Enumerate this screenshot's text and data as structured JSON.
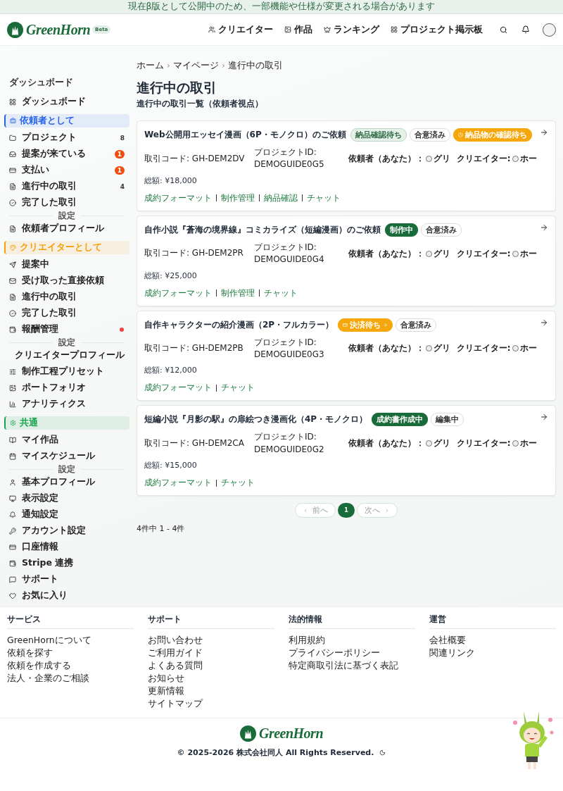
{
  "banner": "現在β版として公開中のため、一部機能や仕様が変更される場合があります",
  "header": {
    "logo": "GreenHorn",
    "badge": "Beta",
    "nav": [
      "クリエイター",
      "作品",
      "ランキング",
      "プロジェクト掲示板"
    ]
  },
  "sidebar": [
    {
      "kind": "label",
      "label": "ダッシュボード"
    },
    {
      "kind": "item",
      "label": "ダッシュボード",
      "alert": false
    },
    {
      "kind": "section",
      "label": "依頼者として",
      "color": "#2563eb"
    },
    {
      "kind": "item",
      "label": "プロジェクト",
      "count": "8",
      "alert": false
    },
    {
      "kind": "item",
      "label": "提案が来ている",
      "badge": "1",
      "alert": false
    },
    {
      "kind": "item",
      "label": "支払い",
      "badge": "1",
      "alert": false
    },
    {
      "kind": "item",
      "label": "進行中の取引",
      "count": "4",
      "alert": false
    },
    {
      "kind": "item",
      "label": "完了した取引",
      "alert": false
    },
    {
      "kind": "divider",
      "label": "設定"
    },
    {
      "kind": "item",
      "label": "依頼者プロフィール",
      "alert": false
    },
    {
      "kind": "section",
      "label": "クリエイターとして",
      "color": "#f59e0b"
    },
    {
      "kind": "item",
      "label": "提案中",
      "alert": false
    },
    {
      "kind": "item",
      "label": "受け取った直接依頼",
      "alert": false
    },
    {
      "kind": "item",
      "label": "進行中の取引",
      "alert": false
    },
    {
      "kind": "item",
      "label": "完了した取引",
      "alert": false
    },
    {
      "kind": "item",
      "label": "報酬管理",
      "alert": true
    },
    {
      "kind": "divider",
      "label": "設定"
    },
    {
      "kind": "item",
      "label": "クリエイタープロフィール",
      "alert": false
    },
    {
      "kind": "item",
      "label": "制作工程プリセット",
      "alert": false
    },
    {
      "kind": "item",
      "label": "ポートフォリオ",
      "alert": false
    },
    {
      "kind": "item",
      "label": "アナリティクス",
      "alert": false
    },
    {
      "kind": "section",
      "label": "共通",
      "color": "#16a34a"
    },
    {
      "kind": "item",
      "label": "マイ作品",
      "alert": false
    },
    {
      "kind": "item",
      "label": "マイスケジュール",
      "alert": false
    },
    {
      "kind": "divider",
      "label": "設定"
    },
    {
      "kind": "item",
      "label": "基本プロフィール",
      "alert": false
    },
    {
      "kind": "item",
      "label": "表示設定",
      "alert": false
    },
    {
      "kind": "item",
      "label": "通知設定",
      "alert": false
    },
    {
      "kind": "item",
      "label": "アカウント設定",
      "alert": false
    },
    {
      "kind": "item",
      "label": "口座情報",
      "alert": false
    },
    {
      "kind": "item",
      "label": "Stripe 連携",
      "alert": false
    },
    {
      "kind": "item",
      "label": "サポート",
      "alert": false
    },
    {
      "kind": "item",
      "label": "お気に入り",
      "alert": false
    }
  ],
  "breadcrumb": [
    "ホーム",
    "マイページ",
    "進行中の取引"
  ],
  "title": "進行中の取引",
  "subtitle": "進行中の取引一覧（依頼者視点）",
  "deals": [
    {
      "title": "Web公開用エッセイ漫画（6P・モノクロ）のご依頼",
      "tags": [
        {
          "label": "納品確認待ち",
          "kind": "soft"
        },
        {
          "label": "合意済み",
          "kind": "outline"
        },
        {
          "label": "納品物の確認待ち",
          "kind": "warning"
        }
      ],
      "code": "取引コード: GH-DEM2DV",
      "project_label": "プロジェクトID:",
      "project_id": "DEMOGUIDE0G5",
      "client_label": "依頼者（あなた）：",
      "client": "グリ",
      "creator_label": "クリエイター:",
      "creator": "ホー",
      "total": "総額: ¥18,000",
      "links": [
        "成約フォーマット",
        "制作管理",
        "納品確認",
        "チャット"
      ]
    },
    {
      "title": "自作小説『蒼海の境界線』コミカライズ（短編漫画）のご依頼",
      "tags": [
        {
          "label": "制作中",
          "kind": "solid"
        },
        {
          "label": "合意済み",
          "kind": "outline"
        }
      ],
      "code": "取引コード: GH-DEM2PR",
      "project_label": "プロジェクトID:",
      "project_id": "DEMOGUIDE0G4",
      "client_label": "依頼者（あなた）：",
      "client": "グリ",
      "creator_label": "クリエイター:",
      "creator": "ホー",
      "total": "総額: ¥25,000",
      "links": [
        "成約フォーマット",
        "制作管理",
        "チャット"
      ]
    },
    {
      "title": "自作キャラクターの紹介漫画（2P・フルカラー）",
      "tags": [
        {
          "label": "決済待ち",
          "kind": "payment"
        },
        {
          "label": "合意済み",
          "kind": "outline"
        }
      ],
      "code": "取引コード: GH-DEM2PB",
      "project_label": "プロジェクトID:",
      "project_id": "DEMOGUIDE0G3",
      "client_label": "依頼者（あなた）：",
      "client": "グリ",
      "creator_label": "クリエイター:",
      "creator": "ホー",
      "total": "総額: ¥12,000",
      "links": [
        "成約フォーマット",
        "チャット"
      ]
    },
    {
      "title": "短編小説『月影の駅』の扉絵つき漫画化（4P・モノクロ）",
      "tags": [
        {
          "label": "成約書作成中",
          "kind": "solid"
        },
        {
          "label": "編集中",
          "kind": "outline"
        }
      ],
      "code": "取引コード: GH-DEM2CA",
      "project_label": "プロジェクトID:",
      "project_id": "DEMOGUIDE0G2",
      "client_label": "依頼者（あなた）：",
      "client": "グリ",
      "creator_label": "クリエイター:",
      "creator": "ホー",
      "total": "総額: ¥15,000",
      "links": [
        "成約フォーマット",
        "チャット"
      ]
    }
  ],
  "pagination": {
    "prev": {
      "label": "前へ",
      "disabled": true
    },
    "pages": [
      {
        "label": "1",
        "selected": true
      }
    ],
    "next": {
      "label": "次へ",
      "disabled": true
    },
    "summary": "4件中 1 - 4件"
  },
  "footer": {
    "columns": [
      {
        "heading": "サービス",
        "links": [
          "GreenHornについて",
          "依頼を探す",
          "依頼を作成する",
          "法人・企業のご相談"
        ]
      },
      {
        "heading": "サポート",
        "links": [
          "お問い合わせ",
          "ご利用ガイド",
          "よくある質問",
          "お知らせ",
          "更新情報",
          "サイトマップ"
        ]
      },
      {
        "heading": "法的情報",
        "links": [
          "利用規約",
          "プライバシーポリシー",
          "特定商取引法に基づく表記"
        ]
      },
      {
        "heading": "運営",
        "links": [
          "会社概要",
          "関連リンク"
        ]
      }
    ],
    "logo": "GreenHorn",
    "copyright": "© 2025-2026 株式会社同人 All Rights Reserved."
  }
}
